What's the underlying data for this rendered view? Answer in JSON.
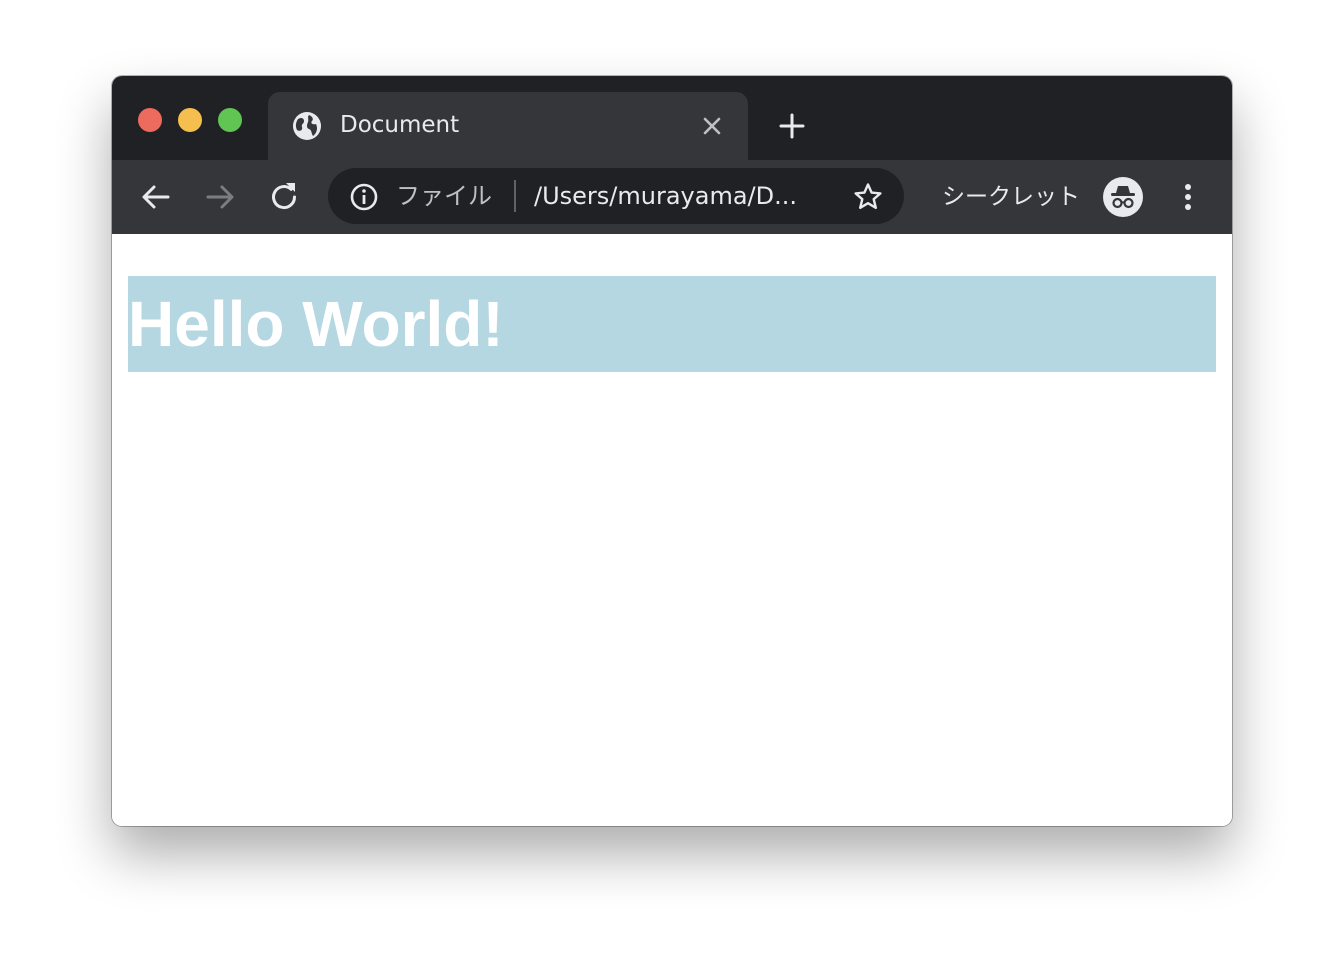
{
  "tab": {
    "title": "Document",
    "favicon": "globe-icon"
  },
  "toolbar": {
    "back_icon": "arrow-left-icon",
    "forward_icon": "arrow-right-icon",
    "reload_icon": "reload-icon"
  },
  "omnibox": {
    "scheme_label": "ファイル",
    "url": "/Users/murayama/D...",
    "info_icon": "info-icon",
    "bookmark_icon": "star-icon"
  },
  "incognito": {
    "label": "シークレット",
    "icon": "incognito-icon"
  },
  "page": {
    "heading": "Hello World!"
  },
  "colors": {
    "titlebar": "#202124",
    "toolbar": "#35363a",
    "omnibox": "#202124",
    "traffic_close": "#ed6a5e",
    "traffic_minimize": "#f5bf4f",
    "traffic_maximize": "#61c554",
    "heading_background": "#b4d7e2",
    "heading_text": "#ffffff"
  }
}
